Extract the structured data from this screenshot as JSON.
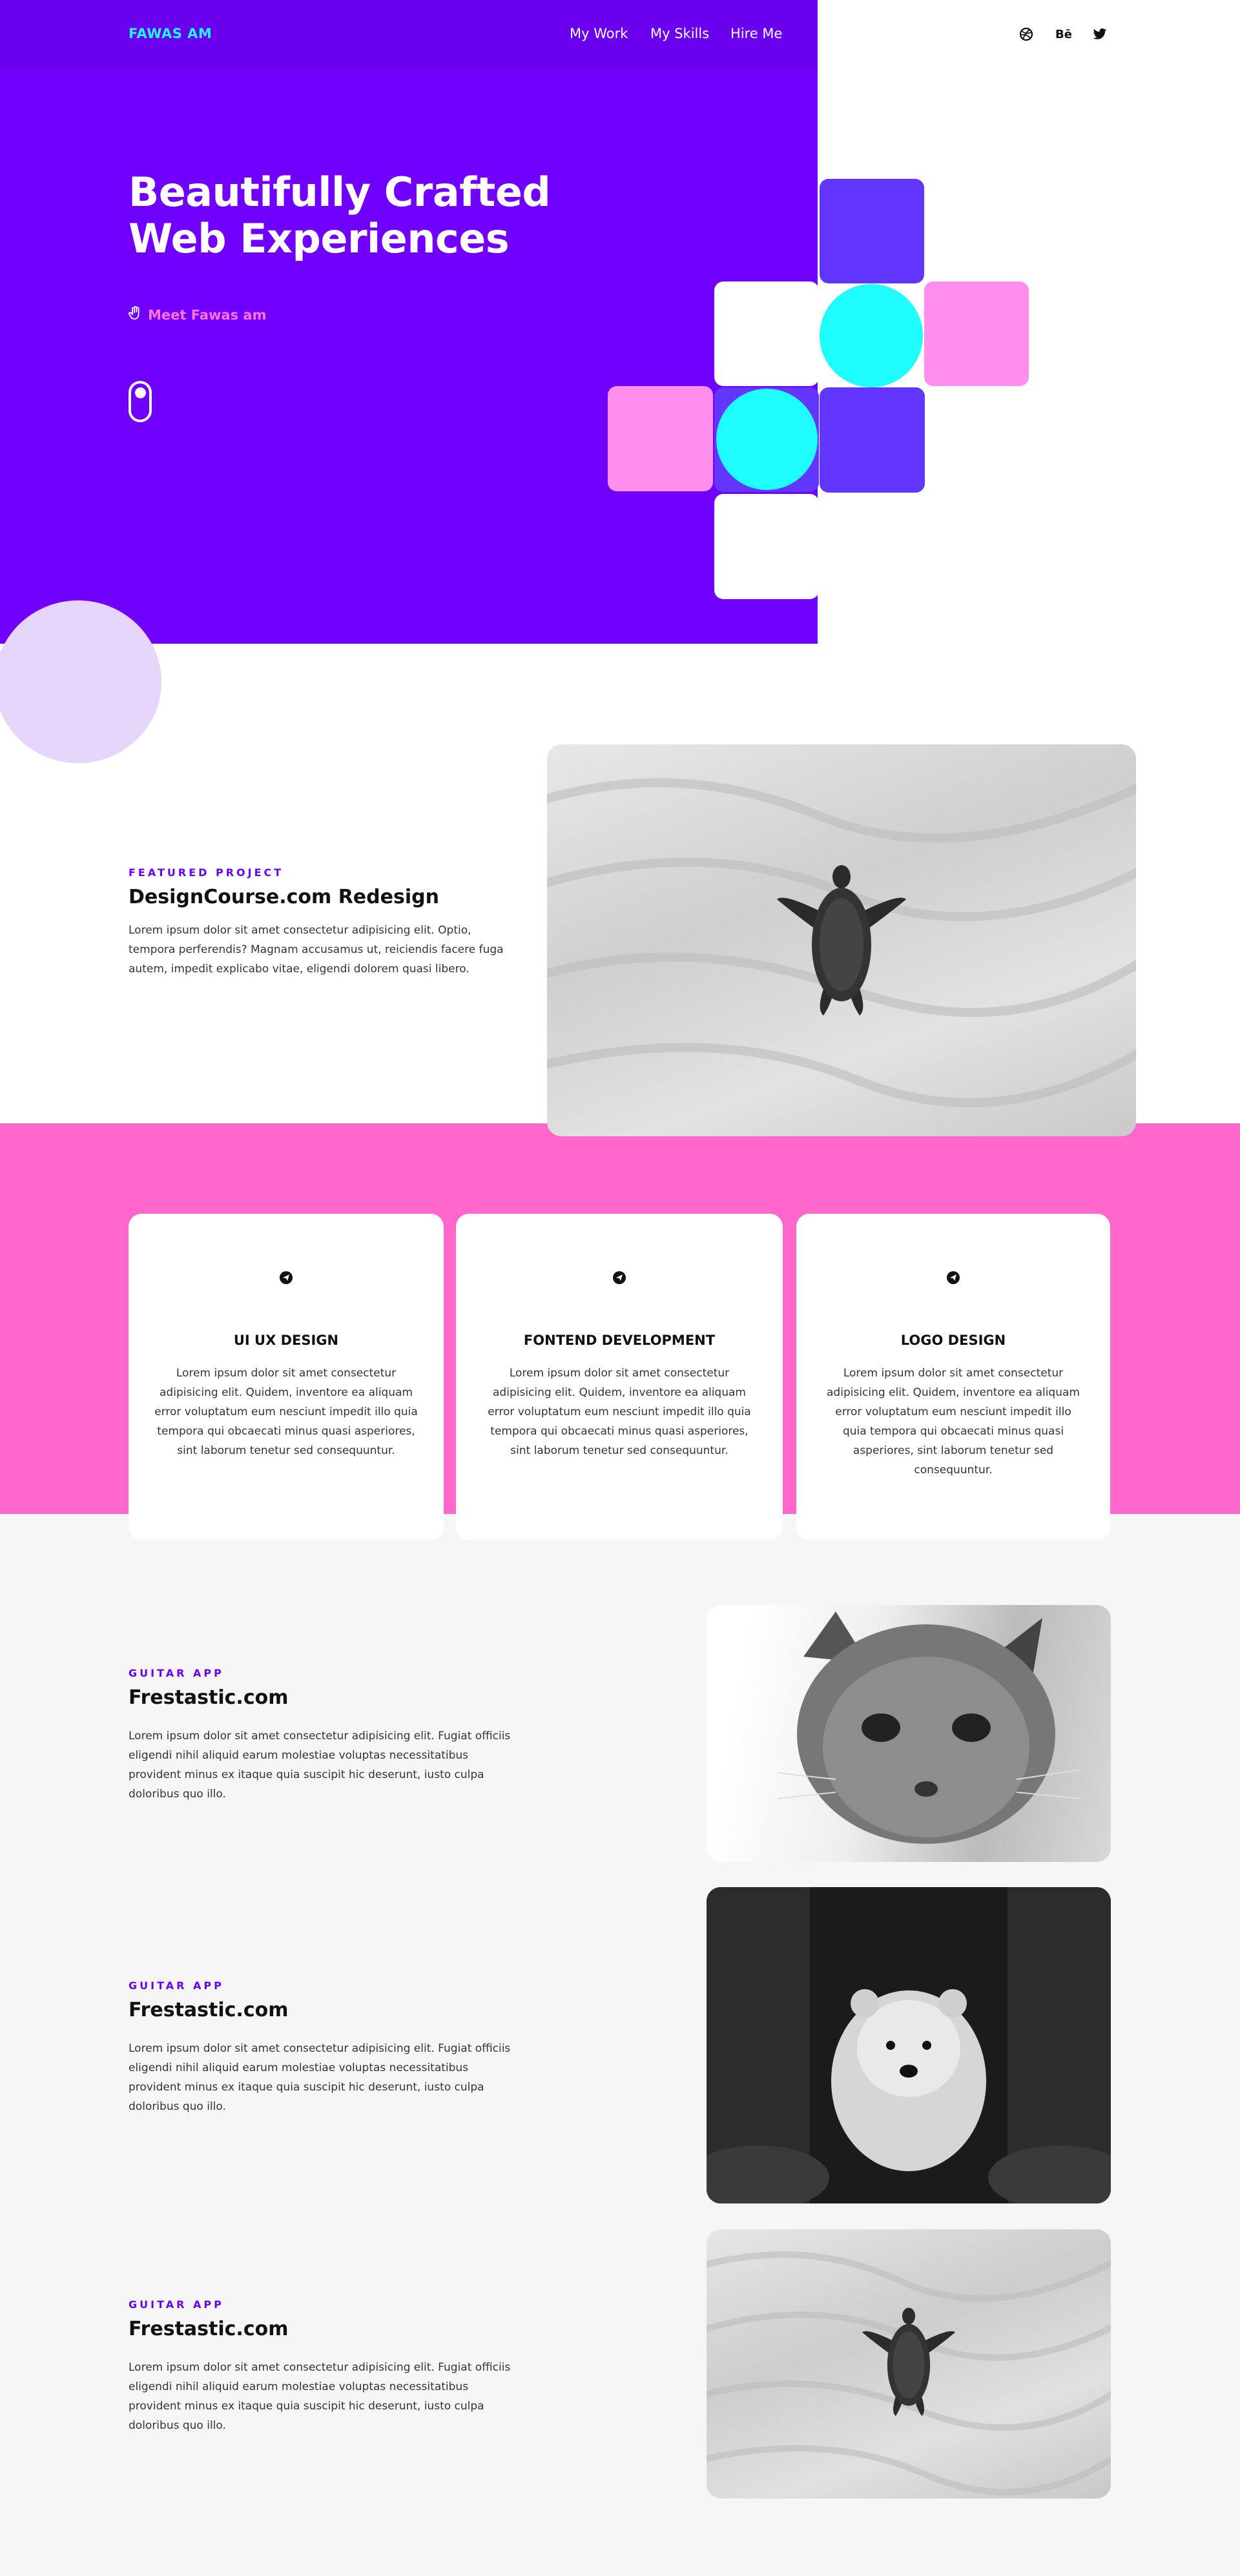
{
  "nav": {
    "logo": "FAWAS AM",
    "links": [
      "My Work",
      "My Skills",
      "Hire Me"
    ],
    "social_icons": [
      "dribbble-icon",
      "behance-icon",
      "twitter-icon"
    ],
    "behance_text": "Bē"
  },
  "hero": {
    "title": "Beautifully Crafted Web Experiences",
    "cta": "Meet Fawas am",
    "scroll_icon": "mouse-scroll-icon"
  },
  "featured": {
    "eyebrow": "FEATURED PROJECT",
    "title": "DesignCourse.com Redesign",
    "text": "Lorem ipsum dolor sit amet consectetur adipisicing elit. Optio, tempora perferendis? Magnam accusamus ut, reiciendis facere fuga autem, impedit explicabo vitae, eligendi dolorem quasi libero.",
    "image": "turtle-on-sand-photo"
  },
  "services": [
    {
      "icon": "send-icon",
      "title": "UI UX DESIGN",
      "text": "Lorem ipsum dolor sit amet consectetur adipisicing elit. Quidem, inventore ea aliquam error voluptatum eum nesciunt impedit illo quia tempora qui obcaecati minus quasi asperiores, sint laborum tenetur sed consequuntur."
    },
    {
      "icon": "send-icon",
      "title": "FONTEND DEVELOPMENT",
      "text": "Lorem ipsum dolor sit amet consectetur adipisicing elit. Quidem, inventore ea aliquam error voluptatum eum nesciunt impedit illo quia tempora qui obcaecati minus quasi asperiores, sint laborum tenetur sed consequuntur."
    },
    {
      "icon": "send-icon",
      "title": "LOGO DESIGN",
      "text": "Lorem ipsum dolor sit amet consectetur adipisicing elit. Quidem, inventore ea aliquam error voluptatum eum nesciunt impedit illo quia tempora qui obcaecati minus quasi asperiores, sint laborum tenetur sed consequuntur."
    }
  ],
  "projects": [
    {
      "eyebrow": "GUITAR APP",
      "title": "Frestastic.com",
      "text": "Lorem ipsum dolor sit amet consectetur adipisicing elit. Fugiat officiis eligendi nihil aliquid earum molestiae voluptas necessitatibus provident minus ex itaque quia suscipit hic deserunt, iusto culpa doloribus quo illo.",
      "image": "kitten-photo"
    },
    {
      "eyebrow": "GUITAR APP",
      "title": "Frestastic.com",
      "text": "Lorem ipsum dolor sit amet consectetur adipisicing elit. Fugiat officiis eligendi nihil aliquid earum molestiae voluptas necessitatibus provident minus ex itaque quia suscipit hic deserunt, iusto culpa doloribus quo illo.",
      "image": "polar-bear-cub-photo"
    },
    {
      "eyebrow": "GUITAR APP",
      "title": "Frestastic.com",
      "text": "Lorem ipsum dolor sit amet consectetur adipisicing elit. Fugiat officiis eligendi nihil aliquid earum molestiae voluptas necessitatibus provident minus ex itaque quia suscipit hic deserunt, iusto culpa doloribus quo illo.",
      "image": "turtle-on-sand-photo"
    }
  ],
  "colors": {
    "hero_purple": "#7000fb",
    "accent_cyan": "#22f7ff",
    "accent_pink": "#ff73e1",
    "indigo_tile": "#6236ff",
    "pink_band": "#ff66cc",
    "grey_band": "#f6f6f6",
    "lavender_circle": "#e5d5fb"
  }
}
